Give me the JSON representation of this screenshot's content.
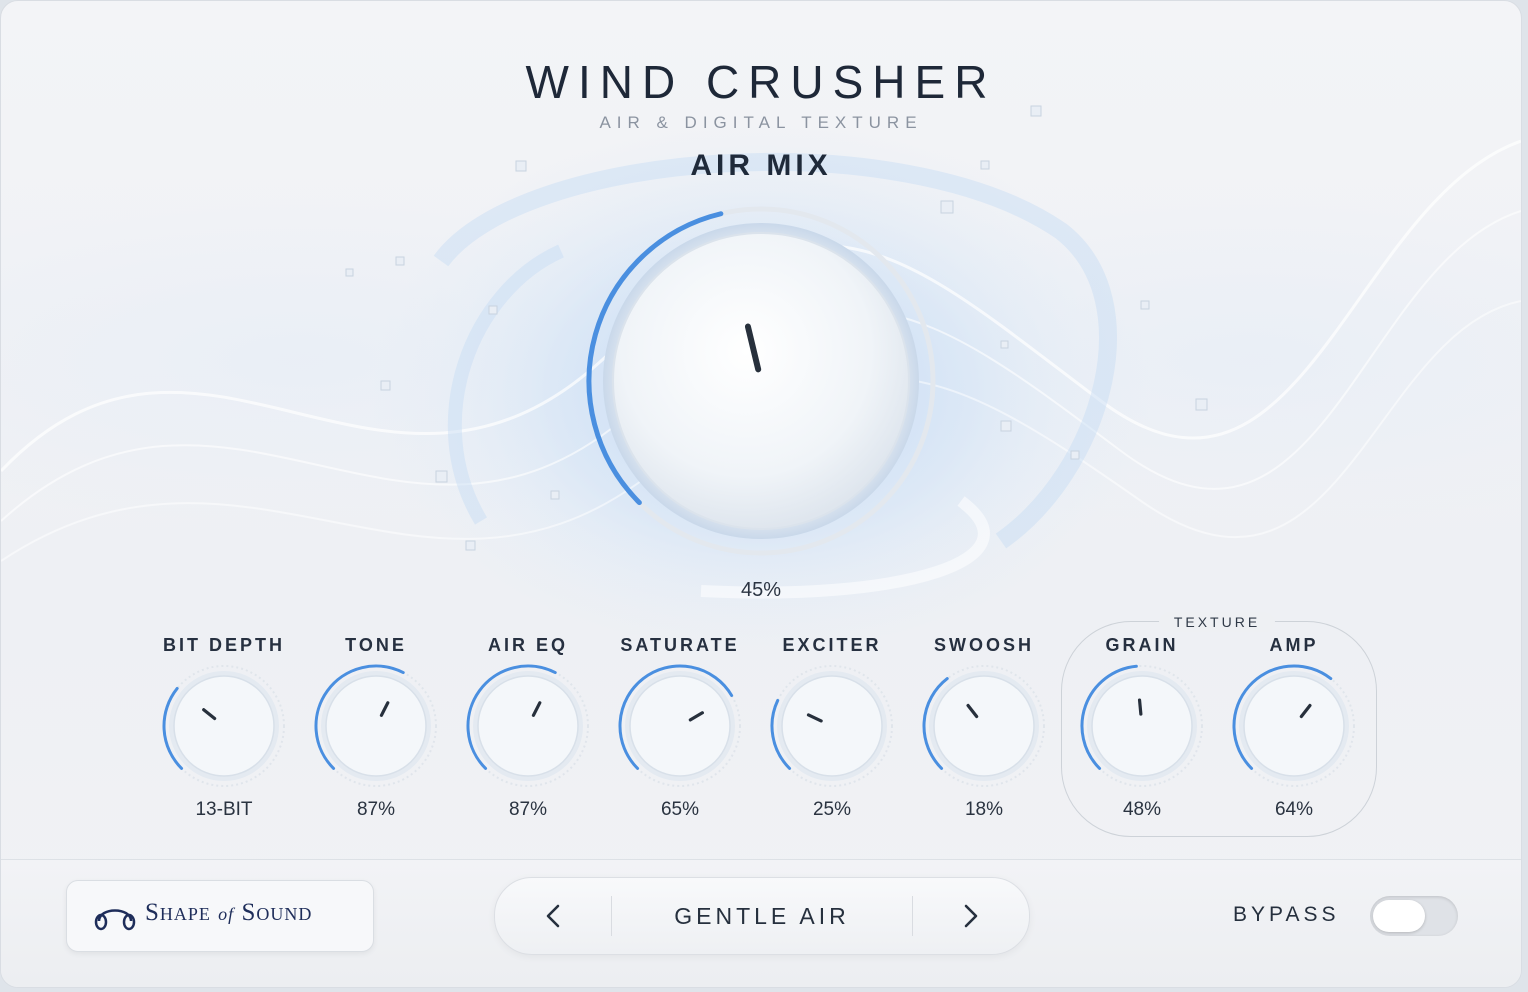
{
  "header": {
    "title": "WIND CRUSHER",
    "subtitle": "AIR & DIGITAL TEXTURE"
  },
  "main_knob": {
    "label": "AIR MIX",
    "value_text": "45%",
    "value": 0.45
  },
  "knobs": [
    {
      "id": "bit-depth",
      "label": "BIT DEPTH",
      "value_text": "13-BIT",
      "value": 0.31
    },
    {
      "id": "tone",
      "label": "TONE",
      "value_text": "87%",
      "value": 0.6
    },
    {
      "id": "air-eq",
      "label": "AIR EQ",
      "value_text": "87%",
      "value": 0.6
    },
    {
      "id": "saturate",
      "label": "SATURATE",
      "value_text": "65%",
      "value": 0.72
    },
    {
      "id": "exciter",
      "label": "EXCITER",
      "value_text": "25%",
      "value": 0.26
    },
    {
      "id": "swoosh",
      "label": "SWOOSH",
      "value_text": "18%",
      "value": 0.36
    },
    {
      "id": "grain",
      "label": "GRAIN",
      "value_text": "48%",
      "value": 0.48
    },
    {
      "id": "amp",
      "label": "AMP",
      "value_text": "64%",
      "value": 0.64
    }
  ],
  "texture_group": {
    "label": "TEXTURE"
  },
  "footer": {
    "brand": {
      "name_part1": "Shape",
      "name_of": "of",
      "name_part2": "Sound"
    },
    "preset": {
      "name": "GENTLE AIR",
      "prev_icon": "chevron-left-icon",
      "next_icon": "chevron-right-icon"
    },
    "bypass": {
      "label": "BYPASS",
      "on": false
    }
  },
  "colors": {
    "accent": "#4a8fe0",
    "text_dark": "#1e2838",
    "knob_face": "#f4f7fa"
  }
}
